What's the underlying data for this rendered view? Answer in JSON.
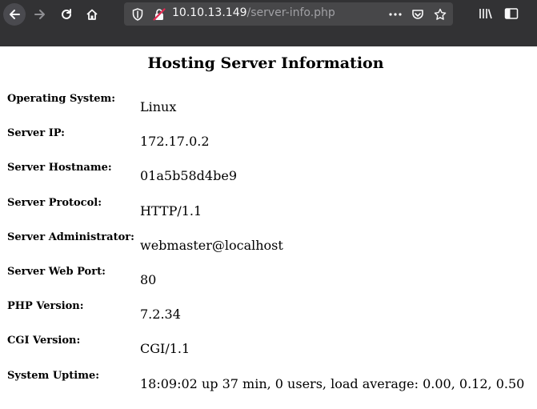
{
  "browser": {
    "url_host": "10.10.13.149",
    "url_path": "/server-info.php",
    "colors": {
      "toolbar_bg": "#323234",
      "urlbar_bg": "#474749",
      "insecure_icon": "#e22850"
    }
  },
  "page": {
    "title": "Hosting Server Information",
    "rows": [
      {
        "label": "Operating System:",
        "value": "Linux"
      },
      {
        "label": "Server IP:",
        "value": "172.17.0.2"
      },
      {
        "label": "Server Hostname:",
        "value": "01a5b58d4be9"
      },
      {
        "label": "Server Protocol:",
        "value": "HTTP/1.1"
      },
      {
        "label": "Server Administrator:",
        "value": "webmaster@localhost"
      },
      {
        "label": "Server Web Port:",
        "value": "80"
      },
      {
        "label": "PHP Version:",
        "value": "7.2.34"
      },
      {
        "label": "CGI Version:",
        "value": "CGI/1.1"
      },
      {
        "label": "System Uptime:",
        "value": "18:09:02 up 37 min, 0 users, load average: 0.00, 0.12, 0.50"
      }
    ]
  }
}
